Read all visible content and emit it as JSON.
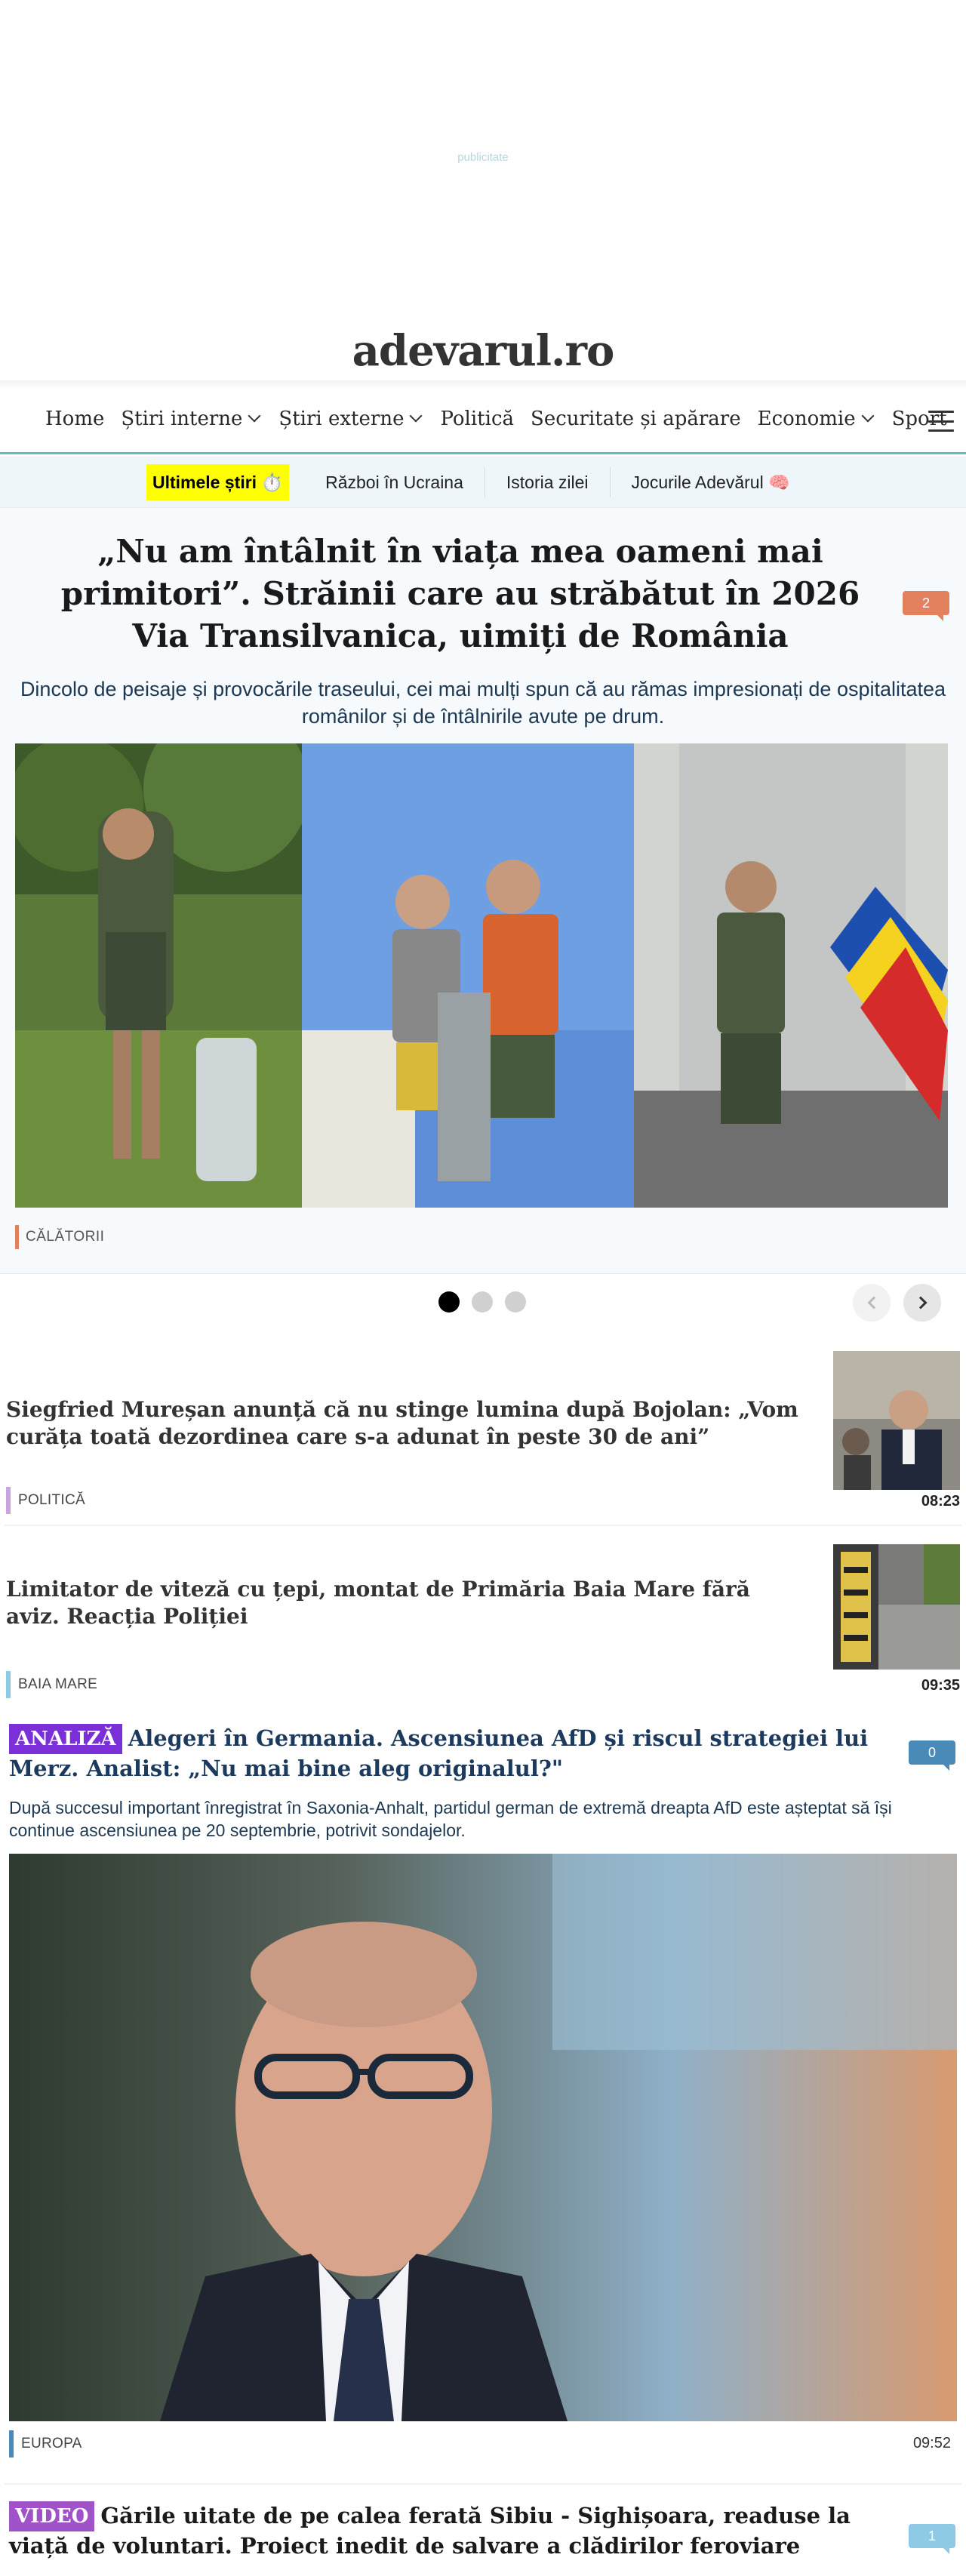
{
  "ad": {
    "label": "publicitate"
  },
  "logo": {
    "text": "adevarul.ro",
    "accent_glyph": "✓"
  },
  "nav": {
    "items": [
      {
        "label": "Home",
        "has_dropdown": false
      },
      {
        "label": "Știri interne",
        "has_dropdown": true
      },
      {
        "label": "Știri externe",
        "has_dropdown": true
      },
      {
        "label": "Politică",
        "has_dropdown": false
      },
      {
        "label": "Securitate și apărare",
        "has_dropdown": false
      },
      {
        "label": "Economie",
        "has_dropdown": true
      },
      {
        "label": "Sport",
        "has_dropdown": false
      }
    ],
    "menu_icon": "hamburger-icon",
    "accent_color": "#5cc0c4"
  },
  "subnav": {
    "items": [
      {
        "label": "Ultimele știri ⏱️",
        "highlight": true
      },
      {
        "label": "Război în Ucraina"
      },
      {
        "label": "Istoria zilei"
      },
      {
        "label": "Jocurile Adevărul 🧠"
      }
    ],
    "highlight_color": "#ffff00"
  },
  "hero": {
    "title": "„Nu am întâlnit în viața mea oameni mai primitori”. Străinii care au străbătut în 2026 Via Transilvanica, uimiți de România",
    "comments": "2",
    "comments_color": "#e3815f",
    "subtitle": "Dincolo de peisaje și provocările traseului, cei mai mulți spun că au rămas impresionați de ospitalitatea românilor și de întâlnirile avute pe drum.",
    "category": "CĂLĂTORII",
    "category_color": "#e3815f"
  },
  "carousel": {
    "dots": 3,
    "active": 0
  },
  "articles": [
    {
      "title": "Siegfried Mureșan anunță că nu stinge lumina după Bojolan: „Vom curăța toată dezordinea care s-a adunat în peste 30 de ani”",
      "category": "POLITICĂ",
      "category_color": "#c9a4e0",
      "time": "08:23"
    },
    {
      "title": "Limitator de viteză cu țepi, montat de Primăria Baia Mare fără aviz. Reacția Poliției",
      "category": "BAIA MARE",
      "category_color": "#8ecae6",
      "time": "09:35"
    }
  ],
  "featured": [
    {
      "label": "ANALIZĂ",
      "label_color": "#7b2fd8",
      "title": "Alegeri în Germania. Ascensiunea AfD și riscul strategiei lui Merz. Analist: „Nu mai bine aleg originalul?\"",
      "title_color": "#1c3a5e",
      "comments": "0",
      "comments_color": "#4a8ab8",
      "subtitle": "După succesul important înregistrat în Saxonia-Anhalt, partidul german de extremă dreapta AfD este așteptat să își continue ascensiunea pe 20 septembrie, potrivit sondajelor.",
      "category": "EUROPA",
      "category_color": "#4a8ab8",
      "time": "09:52"
    },
    {
      "label": "VIDEO",
      "label_color": "#a052c8",
      "title": "Gările uitate de pe calea ferată Sibiu - Sighișoara, readuse la viață de voluntari. Proiect inedit de salvare a clădirilor feroviare",
      "title_color": "#1a1a1a",
      "comments": "1",
      "comments_color": "#8ecae6"
    }
  ]
}
